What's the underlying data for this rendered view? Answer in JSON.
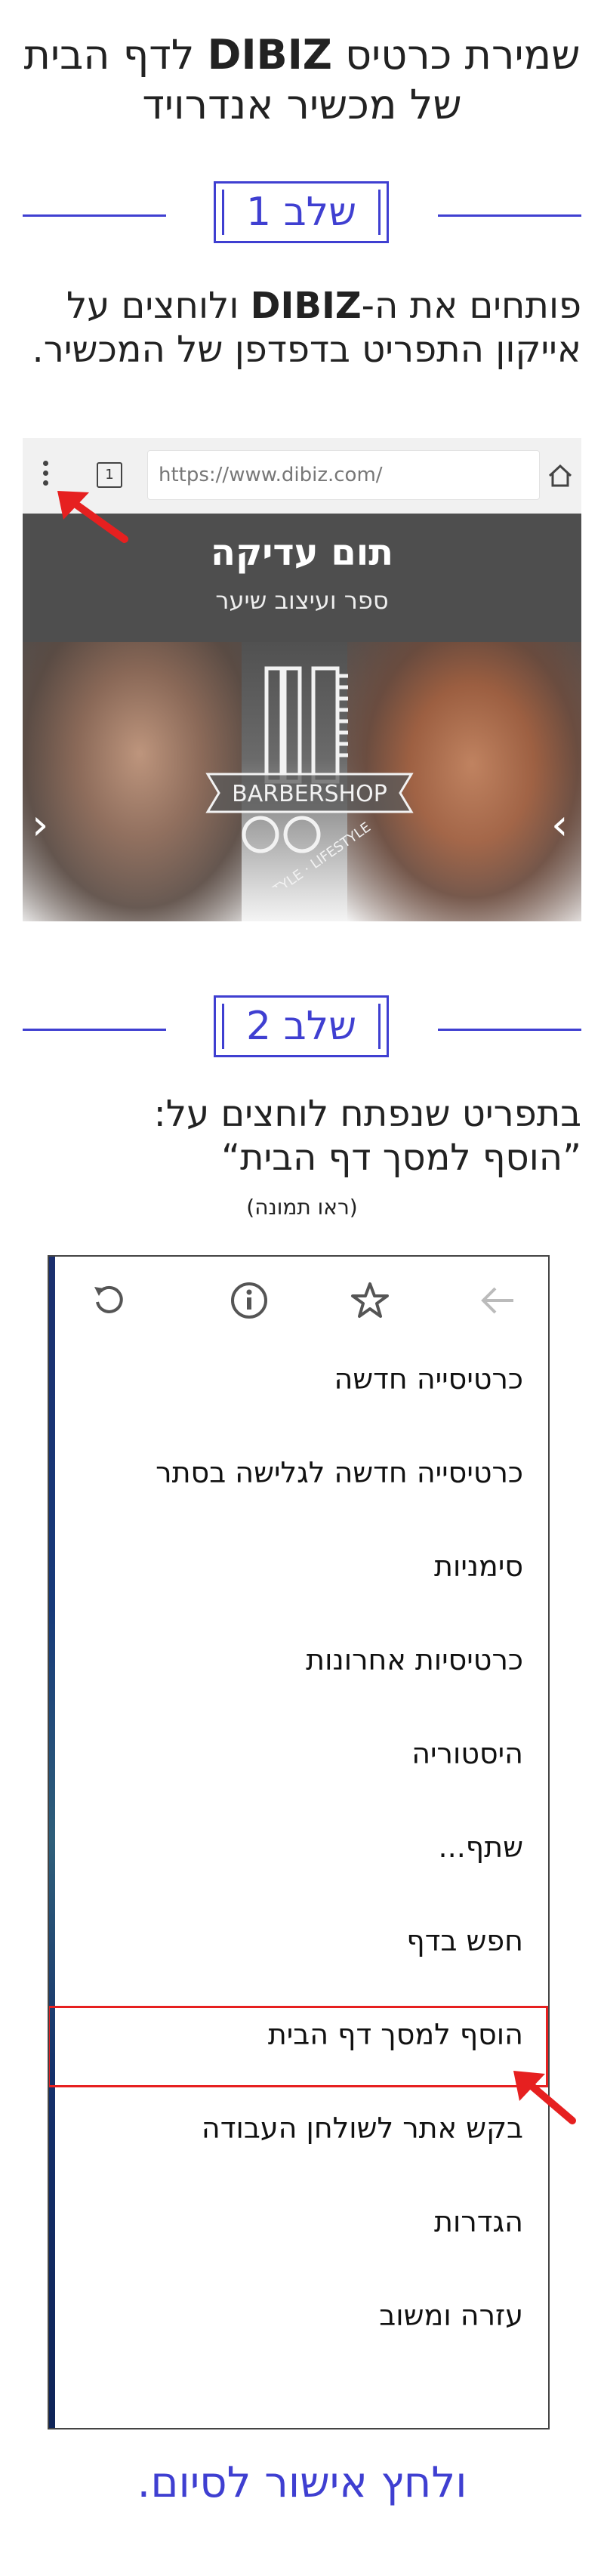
{
  "title": {
    "part1": "שמירת כרטיס",
    "brand": "DIBIZ",
    "part2": "לדף הבית של מכשיר אנדרויד"
  },
  "step1": {
    "label": "שלב 1",
    "desc_part1": "פותחים את ה-",
    "desc_brand": "DIBIZ",
    "desc_part2": " ולוחצים על אייקון התפריט בדפדפן של המכשיר."
  },
  "browser": {
    "tab_count": "1",
    "url": "https://www.dibiz.com/",
    "business_name": "תום עדיקה",
    "business_sub": "ספר ועיצוב שיער",
    "logo_text": "BARBERSHOP",
    "logo_arc": "STYLE · LIFESTYLE"
  },
  "step2": {
    "label": "שלב 2",
    "desc": "בתפריט שנפתח לוחצים על:",
    "quote": "”הוסף למסך דף הבית“",
    "note": "(ראו תמונה)"
  },
  "menu": {
    "icons": [
      "refresh-icon",
      "info-icon",
      "star-icon",
      "back-arrow-icon"
    ],
    "items": [
      "כרטיסייה חדשה",
      "כרטיסייה חדשה לגלישה בסתר",
      "סימניות",
      "כרטיסיות אחרונות",
      "היסטוריה",
      "שתף...",
      "חפש בדף",
      "הוסף למסך דף הבית",
      "בקש אתר לשולחן העבודה",
      "הגדרות",
      "עזרה ומשוב"
    ],
    "highlighted_index": 7
  },
  "finish": "ולחץ אישור לסיום.",
  "colors": {
    "accent": "#3f3fd1",
    "highlight": "#e62020"
  }
}
